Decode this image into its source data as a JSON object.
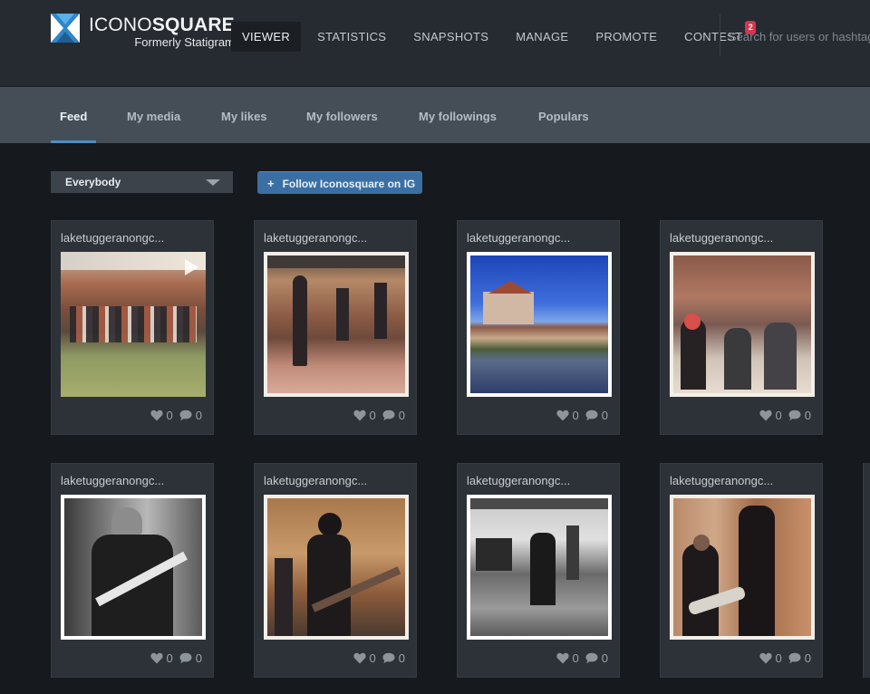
{
  "brand": {
    "name_light": "ICONO",
    "name_bold": "SQUARE",
    "subtitle": "Formerly Statigram",
    "accent": "#4c8fc7"
  },
  "nav": {
    "items": [
      {
        "label": "VIEWER",
        "active": true
      },
      {
        "label": "STATISTICS"
      },
      {
        "label": "SNAPSHOTS"
      },
      {
        "label": "MANAGE"
      },
      {
        "label": "PROMOTE"
      },
      {
        "label": "CONTEST",
        "badge": "2"
      }
    ],
    "search_placeholder": "Search for users or hashtags"
  },
  "subnav": {
    "tabs": [
      {
        "label": "Feed",
        "active": true
      },
      {
        "label": "My media"
      },
      {
        "label": "My likes"
      },
      {
        "label": "My followers"
      },
      {
        "label": "My followings"
      },
      {
        "label": "Populars"
      }
    ]
  },
  "controls": {
    "filter_value": "Everybody",
    "follow_plus": "+",
    "follow_label": "Follow Iconosquare on IG"
  },
  "cards": [
    {
      "user": "laketuggeranongc...",
      "likes": "0",
      "comments": "0",
      "video": true
    },
    {
      "user": "laketuggeranongc...",
      "likes": "0",
      "comments": "0"
    },
    {
      "user": "laketuggeranongc...",
      "likes": "0",
      "comments": "0"
    },
    {
      "user": "laketuggeranongc...",
      "likes": "0",
      "comments": "0"
    },
    {
      "user": "laketuggeranongc...",
      "likes": "0",
      "comments": "0"
    },
    {
      "user": "laketuggeranongc...",
      "likes": "0",
      "comments": "0"
    },
    {
      "user": "laketuggeranongc...",
      "likes": "0",
      "comments": "0"
    },
    {
      "user": "laketuggeranongc...",
      "likes": "0",
      "comments": "0"
    }
  ]
}
